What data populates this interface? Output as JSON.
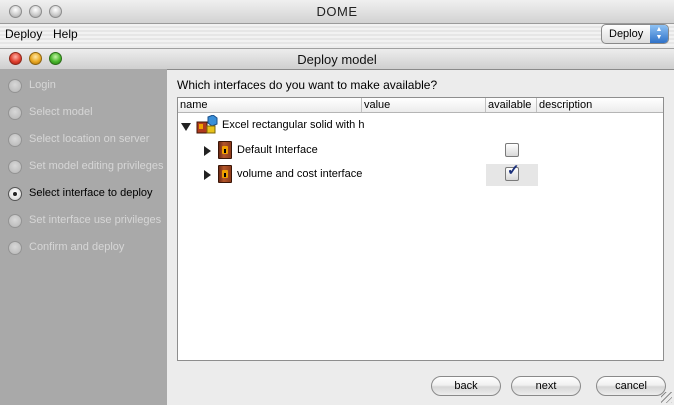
{
  "outer_window": {
    "title": "DOME"
  },
  "menubar": {
    "items": [
      "Deploy",
      "Help"
    ],
    "mode_select": {
      "value": "Deploy"
    }
  },
  "dialog": {
    "title": "Deploy model"
  },
  "steps": [
    {
      "label": "Login",
      "selected": false
    },
    {
      "label": "Select model",
      "selected": false
    },
    {
      "label": "Select location on server",
      "selected": false
    },
    {
      "label": "Set model editing privileges",
      "selected": false
    },
    {
      "label": "Select interface to deploy",
      "selected": true
    },
    {
      "label": "Set interface use privileges",
      "selected": false
    },
    {
      "label": "Confirm and deploy",
      "selected": false
    }
  ],
  "question": "Which interfaces do you want to make available?",
  "table": {
    "columns": [
      "name",
      "value",
      "available",
      "description"
    ],
    "root": {
      "label": "Excel rectangular solid with h",
      "expanded": true
    },
    "rows": [
      {
        "label": "Default Interface",
        "available": false
      },
      {
        "label": "volume and cost interface",
        "available": true
      }
    ]
  },
  "buttons": {
    "back": "back",
    "next": "next",
    "cancel": "cancel"
  },
  "colors": {
    "check": "#1a2f7a",
    "steps_panel": "#a9a9a9"
  }
}
